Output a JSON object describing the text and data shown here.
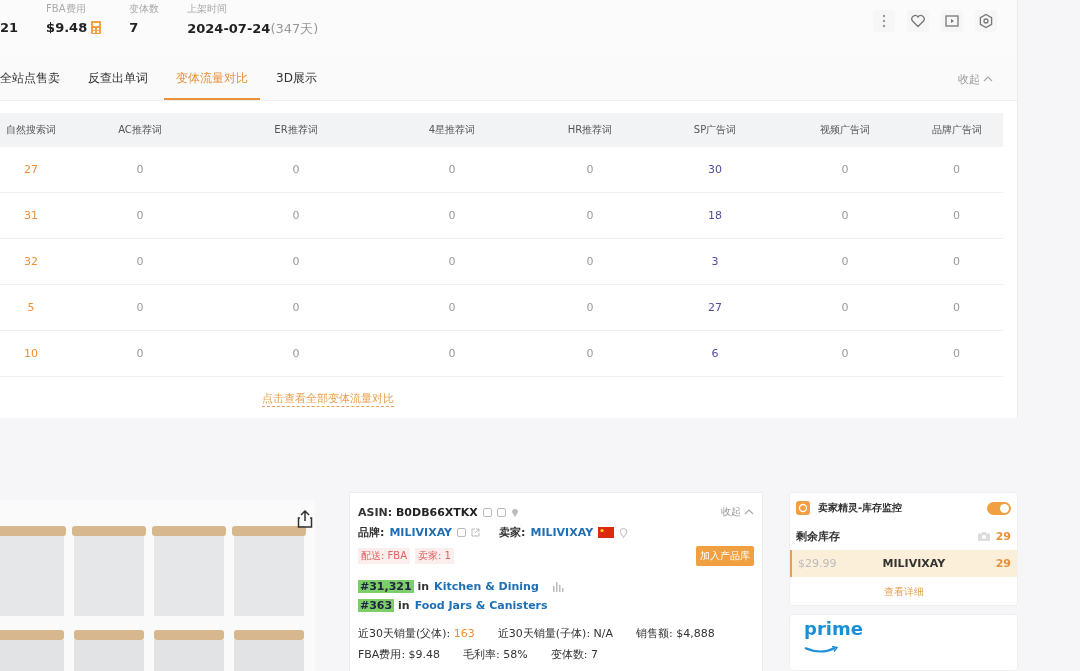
{
  "header": {
    "stats": [
      {
        "kind": "plain",
        "value": "21"
      },
      {
        "kind": "calc",
        "label": "FBA费用",
        "value": "$9.48"
      },
      {
        "kind": "plain",
        "label": "变体数",
        "value": "7"
      },
      {
        "kind": "note",
        "label": "上架时间",
        "value": "2024-07-24",
        "note": "(347天)"
      }
    ]
  },
  "tabs": [
    {
      "label": "全站点售卖",
      "selected": false
    },
    {
      "label": "反查出单词",
      "selected": false
    },
    {
      "label": "变体流量对比",
      "selected": true
    },
    {
      "label": "3D展示",
      "selected": false
    }
  ],
  "collapse": "收起",
  "table": {
    "columns": [
      {
        "label": "自然搜索词",
        "color": "#e8913a"
      },
      {
        "label": "AC推荐词"
      },
      {
        "label": "ER推荐词"
      },
      {
        "label": "4星推荐词"
      },
      {
        "label": "HR推荐词"
      },
      {
        "label": "SP广告词",
        "color": "#4f4fa0"
      },
      {
        "label": "视频广告词"
      },
      {
        "label": "品牌广告词"
      }
    ],
    "rows": [
      [
        "27",
        "0",
        "0",
        "0",
        "0",
        "30",
        "0",
        "0"
      ],
      [
        "31",
        "0",
        "0",
        "0",
        "0",
        "18",
        "0",
        "0"
      ],
      [
        "32",
        "0",
        "0",
        "0",
        "0",
        "3",
        "0",
        "0"
      ],
      [
        "5",
        "0",
        "0",
        "0",
        "0",
        "27",
        "0",
        "0"
      ],
      [
        "10",
        "0",
        "0",
        "0",
        "0",
        "6",
        "0",
        "0"
      ]
    ],
    "link": "点击查看全部变体流量对比"
  },
  "product": {
    "image": {
      "kind": "picture"
    },
    "asin_label": "ASIN:",
    "asin": "B0DB66XTKX",
    "collapse": "收起",
    "brand_label": "品牌:",
    "brand": "MILIVIXAY",
    "seller_label": "卖家:",
    "seller": "MILIVIXAY",
    "tags": [
      "配送: FBA",
      "卖家: 1"
    ],
    "add_button": "加入产品库",
    "ranks": [
      {
        "rank": "#31,321",
        "in": "in",
        "category": "Kitchen & Dining",
        "chart": true
      },
      {
        "rank": "#363",
        "in": "in",
        "category": "Food Jars & Canisters",
        "chart": false
      }
    ],
    "metrics": [
      [
        {
          "label": "近30天销量(父体):",
          "value": "163",
          "highlight": true
        },
        {
          "label": "近30天销量(子体):",
          "value": "N/A",
          "highlight": false
        },
        {
          "label": "销售额:",
          "value": "$4,888",
          "highlight": false
        }
      ],
      [
        {
          "label": "FBA费用:",
          "value": "$9.48",
          "highlight": false
        },
        {
          "label": "毛利率:",
          "value": "58%",
          "highlight": false
        },
        {
          "label": "变体数:",
          "value": "7",
          "highlight": false
        }
      ]
    ]
  },
  "stock": {
    "title": "卖家精灵-库存监控",
    "on": true,
    "remaining_label": "剩余库存",
    "remaining": "29",
    "rows": [
      {
        "price": "$29.99",
        "seller": "MILIVIXAY",
        "qty": "29"
      }
    ],
    "link": "查看详细"
  },
  "prime": {
    "logo": "prime"
  }
}
